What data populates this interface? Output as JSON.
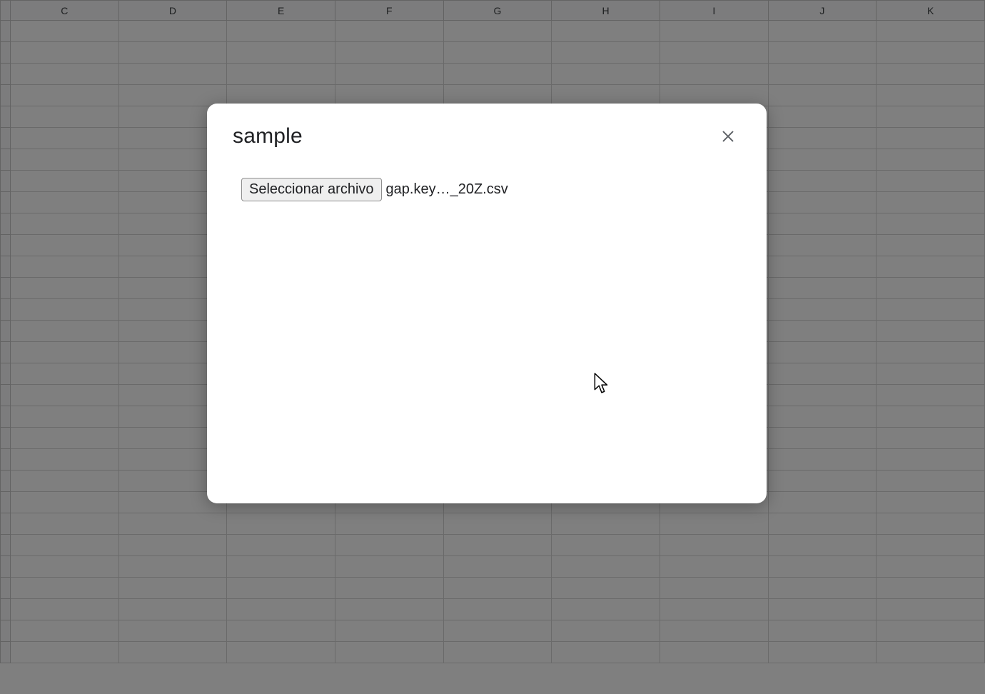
{
  "spreadsheet": {
    "columns": [
      "C",
      "D",
      "E",
      "F",
      "G",
      "H",
      "I",
      "J",
      "K"
    ],
    "visible_row_count": 30
  },
  "dialog": {
    "title": "sample",
    "file_button_label": "Seleccionar archivo",
    "selected_file_name": "gap.key…_20Z.csv"
  }
}
